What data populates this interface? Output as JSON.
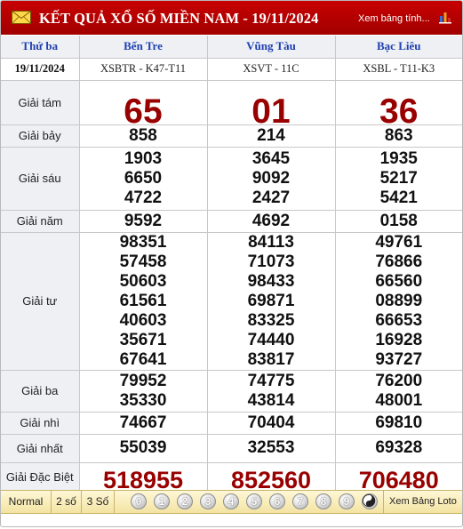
{
  "header": {
    "title": "KẾT QUẢ XỔ SỐ MIỀN NAM - 19/11/2024",
    "link": "Xem bảng tính..."
  },
  "table": {
    "day_of_week": "Thứ ba",
    "date": "19/11/2024",
    "provinces": [
      {
        "name": "Bến Tre",
        "code": "XSBTR - K47-T11"
      },
      {
        "name": "Vũng Tàu",
        "code": "XSVT - 11C"
      },
      {
        "name": "Bạc Liêu",
        "code": "XSBL - T11-K3"
      }
    ],
    "prizes": [
      {
        "label": "Giải tám",
        "results": [
          [
            "65"
          ],
          [
            "01"
          ],
          [
            "36"
          ]
        ]
      },
      {
        "label": "Giải bảy",
        "results": [
          [
            "858"
          ],
          [
            "214"
          ],
          [
            "863"
          ]
        ]
      },
      {
        "label": "Giải sáu",
        "results": [
          [
            "1903",
            "6650",
            "4722"
          ],
          [
            "3645",
            "9092",
            "2427"
          ],
          [
            "1935",
            "5217",
            "5421"
          ]
        ]
      },
      {
        "label": "Giải năm",
        "results": [
          [
            "9592"
          ],
          [
            "4692"
          ],
          [
            "0158"
          ]
        ]
      },
      {
        "label": "Giải tư",
        "results": [
          [
            "98351",
            "57458",
            "50603",
            "61561",
            "40603",
            "35671",
            "67641"
          ],
          [
            "84113",
            "71073",
            "98433",
            "69871",
            "83325",
            "74440",
            "83817"
          ],
          [
            "49761",
            "76866",
            "66560",
            "08899",
            "66653",
            "16928",
            "93727"
          ]
        ]
      },
      {
        "label": "Giải ba",
        "results": [
          [
            "79952",
            "35330"
          ],
          [
            "74775",
            "43814"
          ],
          [
            "76200",
            "48001"
          ]
        ]
      },
      {
        "label": "Giải nhì",
        "results": [
          [
            "74667"
          ],
          [
            "70404"
          ],
          [
            "69810"
          ]
        ]
      },
      {
        "label": "Giải nhất",
        "results": [
          [
            "55039"
          ],
          [
            "32553"
          ],
          [
            "69328"
          ]
        ]
      },
      {
        "label": "Giải Đặc Biệt",
        "results": [
          [
            "518955"
          ],
          [
            "852560"
          ],
          [
            "706480"
          ]
        ]
      }
    ]
  },
  "toolbar": {
    "modes": [
      "Normal",
      "2 số",
      "3 Số"
    ],
    "digits": [
      "0",
      "1",
      "2",
      "3",
      "4",
      "5",
      "6",
      "7",
      "8",
      "9"
    ],
    "loto_link": "Xem Bảng Loto"
  },
  "colors": {
    "header_red": "#b40000",
    "highlight_red": "#990000",
    "province_blue": "#1f3fb0",
    "toolbar_yellow": "#f6e9b0"
  },
  "icons": {
    "mail": "envelope-icon",
    "chart": "bar-chart-icon",
    "clear": "yin-yang-icon"
  }
}
